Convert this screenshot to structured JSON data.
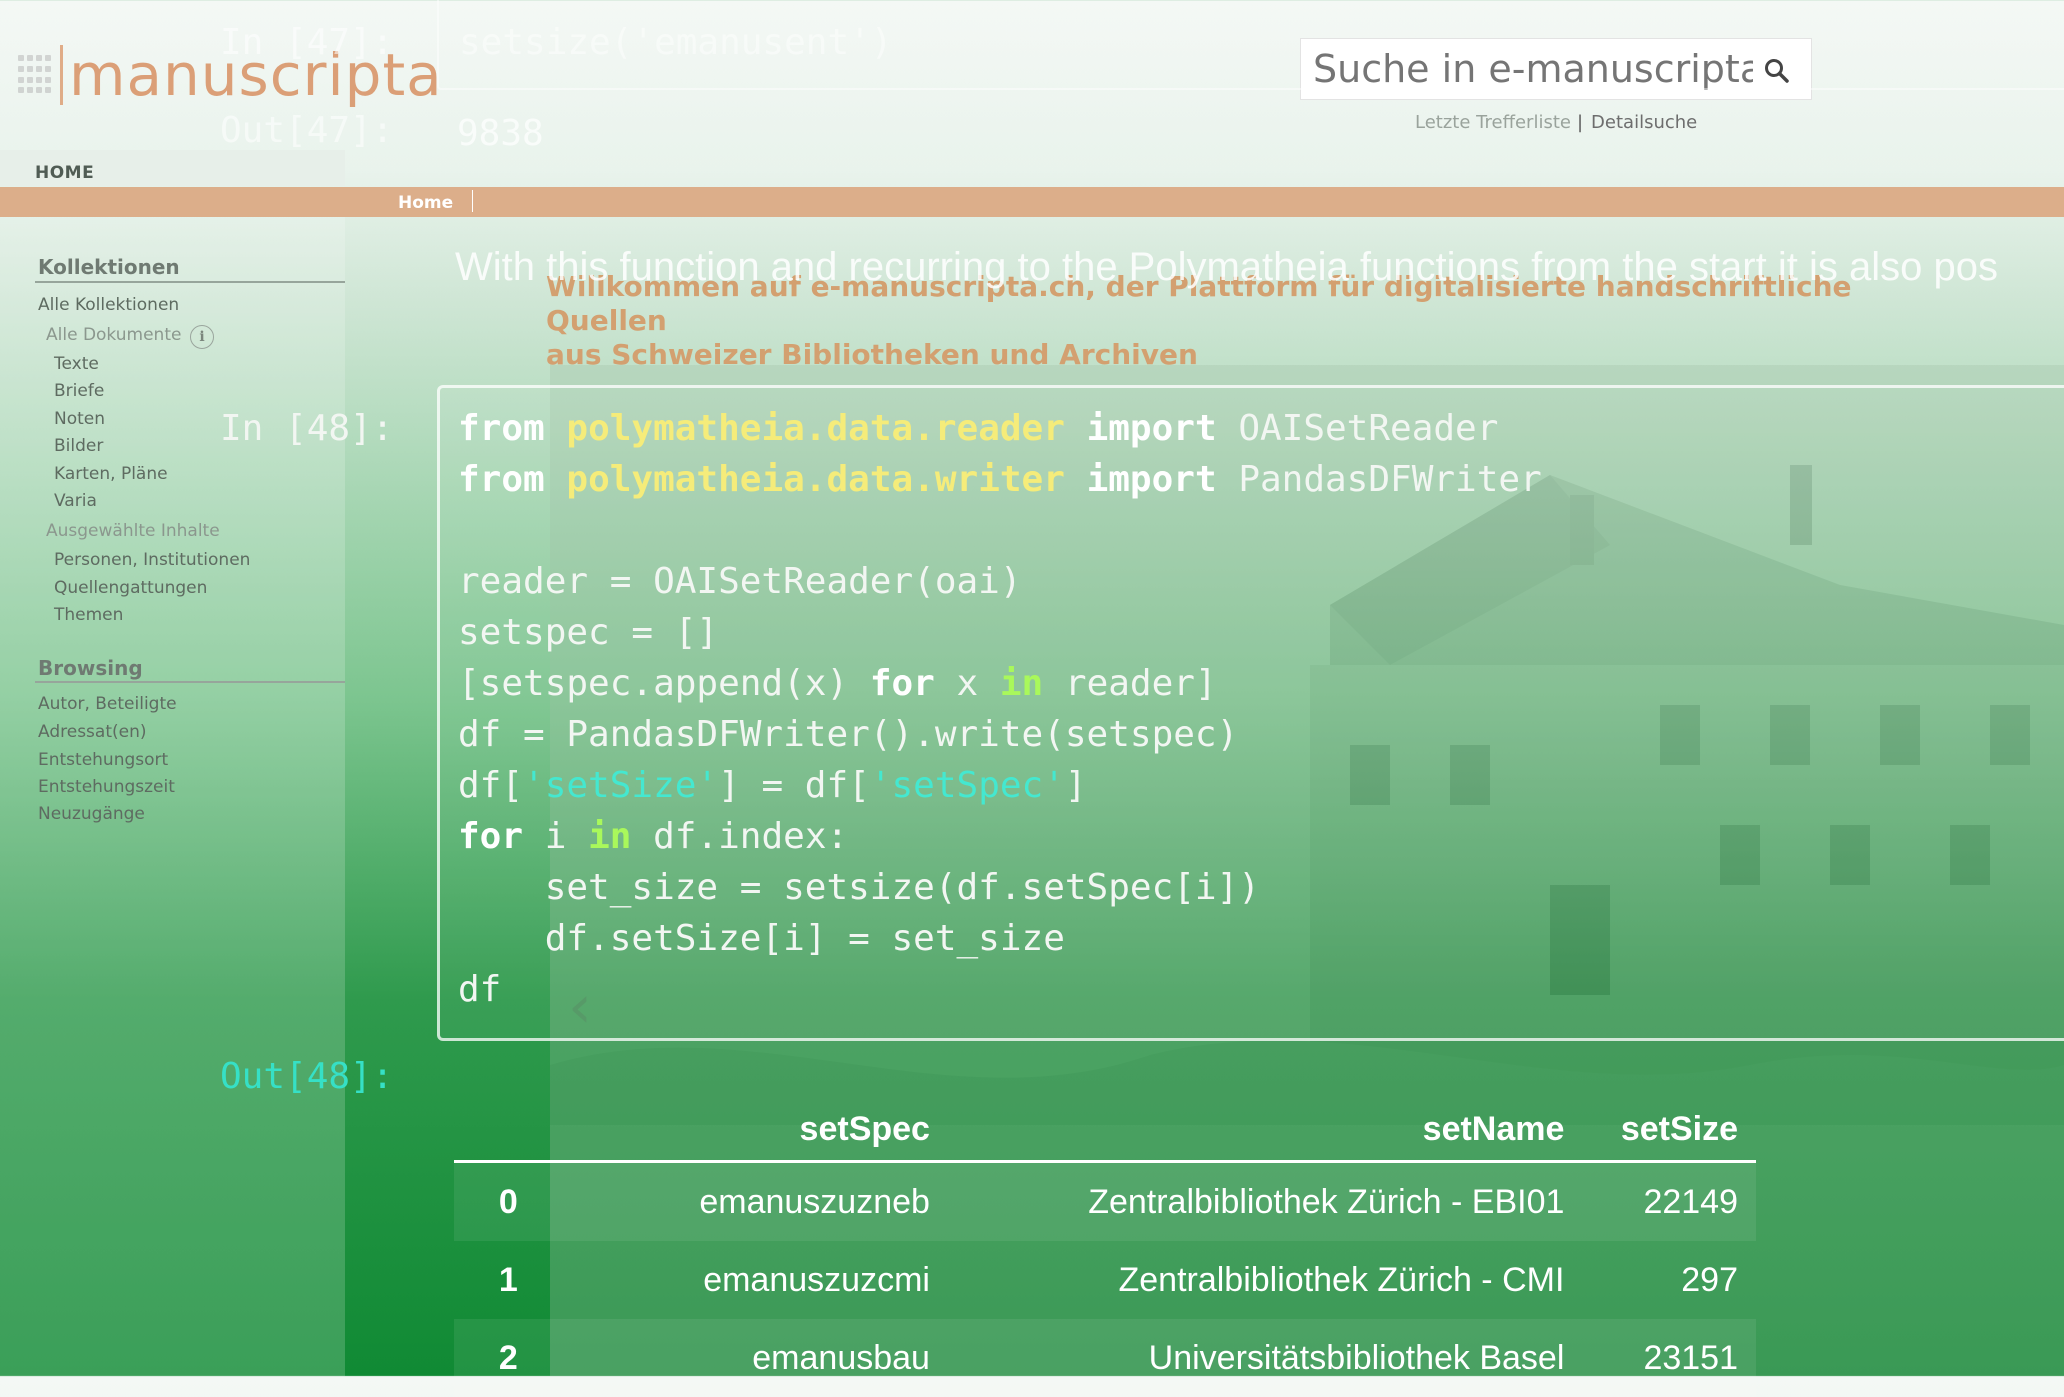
{
  "website": {
    "logo_text": "manuscripta",
    "search": {
      "placeholder": "Suche in e-manuscripta",
      "links": [
        "Letzte Trefferliste",
        "Detailsuche"
      ]
    },
    "home_tab": "HOME",
    "nav": {
      "home": "Home"
    },
    "welcome": {
      "line1": "Willkommen auf e-manuscripta.ch, der Plattform für digitalisierte handschriftliche Quellen",
      "line2": "aus Schweizer Bibliotheken und Archiven"
    },
    "sidebar": {
      "kollektionen": {
        "heading": "Kollektionen",
        "all_collections": "Alle Kollektionen",
        "all_documents": "Alle Dokumente",
        "info": "i",
        "types": [
          "Texte",
          "Briefe",
          "Noten",
          "Bilder",
          "Karten, Pläne",
          "Varia"
        ],
        "selected": "Ausgewählte Inhalte",
        "selected_items": [
          "Personen, Institutionen",
          "Quellengattungen",
          "Themen"
        ]
      },
      "browsing": {
        "heading": "Browsing",
        "items": [
          "Autor, Beteiligte",
          "Adressat(en)",
          "Entstehungsort",
          "Entstehungszeit",
          "Neuzugänge"
        ]
      }
    }
  },
  "notebook": {
    "cell47": {
      "in_prompt": "In [47]:",
      "code": "setsize('emanusent')",
      "out_prompt": "Out[47]:",
      "output": "9838"
    },
    "markdown": "With this function and recurring to the Polymatheia functions from the start it is also pos",
    "cell48": {
      "in_prompt": "In [48]:",
      "out_prompt": "Out[48]:",
      "code": {
        "l1": {
          "from": "from",
          "module": "polymatheia.data.reader",
          "import": "import",
          "name": "OAISetReader"
        },
        "l2": {
          "from": "from",
          "module": "polymatheia.data.writer",
          "import": "import",
          "name": "PandasDFWriter"
        },
        "l3": "reader = OAISetReader(oai)",
        "l4": "setspec = []",
        "l5": {
          "a": "[setspec.append(x) ",
          "for": "for",
          "b": " x ",
          "in": "in",
          "c": " reader]"
        },
        "l6": "df = PandasDFWriter().write(setspec)",
        "l7": {
          "a": "df[",
          "s1": "'setSize'",
          "b": "] = df[",
          "s2": "'setSpec'",
          "c": "]"
        },
        "l8": {
          "for": "for",
          "a": " i ",
          "in": "in",
          "b": " df.index:"
        },
        "l9": "    set_size = setsize(df.setSpec[i])",
        "l10": "    df.setSize[i] = set_size",
        "l11": "df"
      }
    },
    "table": {
      "columns": [
        "",
        "setSpec",
        "setName",
        "setSize"
      ],
      "rows": [
        [
          "0",
          "emanuszuzneb",
          "Zentralbibliothek Zürich - EBI01",
          "22149"
        ],
        [
          "1",
          "emanuszuzcmi",
          "Zentralbibliothek Zürich - CMI",
          "297"
        ],
        [
          "2",
          "emanusbau",
          "Universitätsbibliothek Basel",
          "23151"
        ]
      ]
    }
  },
  "colors": {
    "accent_orange": "#dcae8a",
    "string_cyan": "#44e8d0",
    "module_yellow": "#f5ec7a",
    "keyword_green": "#a9f85b"
  }
}
